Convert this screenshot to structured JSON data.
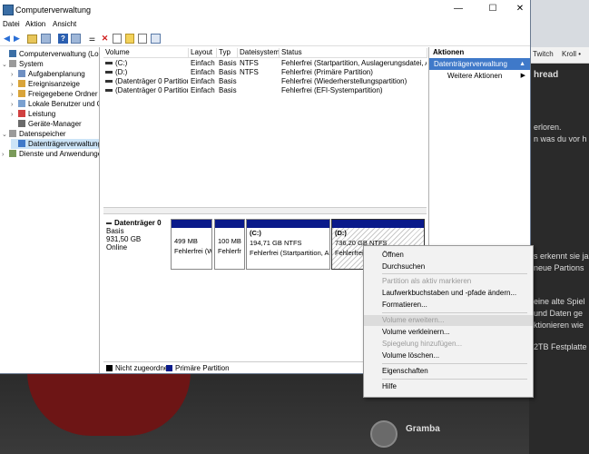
{
  "window": {
    "title": "Computerverwaltung",
    "minimize_icon": "—",
    "maximize_icon": "☐",
    "close_icon": "✕"
  },
  "menu": [
    "Datei",
    "Aktion",
    "Ansicht"
  ],
  "tree": [
    {
      "label": "Computerverwaltung (Lokal)",
      "level": 0,
      "caret": ""
    },
    {
      "label": "System",
      "level": 0,
      "caret": "⌄"
    },
    {
      "label": "Aufgabenplanung",
      "level": 1,
      "caret": "›"
    },
    {
      "label": "Ereignisanzeige",
      "level": 1,
      "caret": "›"
    },
    {
      "label": "Freigegebene Ordner",
      "level": 1,
      "caret": "›"
    },
    {
      "label": "Lokale Benutzer und Gr",
      "level": 1,
      "caret": "›"
    },
    {
      "label": "Leistung",
      "level": 1,
      "caret": "›"
    },
    {
      "label": "Geräte-Manager",
      "level": 1,
      "caret": ""
    },
    {
      "label": "Datenspeicher",
      "level": 0,
      "caret": "⌄"
    },
    {
      "label": "Datenträgerverwaltung",
      "level": 1,
      "caret": ""
    },
    {
      "label": "Dienste und Anwendungen",
      "level": 0,
      "caret": "›"
    }
  ],
  "table": {
    "headers": [
      "Volume",
      "Layout",
      "Typ",
      "Dateisystem",
      "Status"
    ],
    "rows": [
      [
        "(C:)",
        "Einfach",
        "Basis",
        "NTFS",
        "Fehlerfrei (Startpartition, Auslagerungsdatei, Abstu"
      ],
      [
        "(D:)",
        "Einfach",
        "Basis",
        "NTFS",
        "Fehlerfrei (Primäre Partition)"
      ],
      [
        "(Datenträger 0 Partition 1)",
        "Einfach",
        "Basis",
        "",
        "Fehlerfrei (Wiederherstellungspartition)"
      ],
      [
        "(Datenträger 0 Partition 2)",
        "Einfach",
        "Basis",
        "",
        "Fehlerfrei (EFI-Systempartition)"
      ]
    ]
  },
  "disk": {
    "name": "Datenträger 0",
    "type": "Basis",
    "size": "931,50 GB",
    "status": "Online",
    "partitions": [
      {
        "title": "",
        "size": "499 MB",
        "status": "Fehlerfrei (W"
      },
      {
        "title": "",
        "size": "100 MB",
        "status": "Fehlerfr"
      },
      {
        "title": "(C:)",
        "size": "194,71 GB NTFS",
        "status": "Fehlerfrei (Startpartition, A"
      },
      {
        "title": "(D:)",
        "size": "736,20 GB NTFS",
        "status": "Fehlerfrei (Pri"
      }
    ]
  },
  "legend": {
    "unallocated": "Nicht zugeordnet",
    "primary": "Primäre Partition",
    "unallocated_color": "#000000",
    "primary_color": "#0a1a8a"
  },
  "actions": {
    "header": "Aktionen",
    "selected": "Datenträgerverwaltung",
    "more": "Weitere Aktionen"
  },
  "context_menu": [
    {
      "label": "Öffnen",
      "disabled": false
    },
    {
      "label": "Durchsuchen",
      "disabled": false
    },
    {
      "label": "Partition als aktiv markieren",
      "disabled": true
    },
    {
      "label": "Laufwerkbuchstaben und -pfade ändern...",
      "disabled": false
    },
    {
      "label": "Formatieren...",
      "disabled": false
    },
    {
      "label": "Volume erweitern...",
      "disabled": true
    },
    {
      "label": "Volume verkleinern...",
      "disabled": false
    },
    {
      "label": "Spiegelung hinzufügen...",
      "disabled": true
    },
    {
      "label": "Volume löschen...",
      "disabled": false
    },
    {
      "label": "Eigenschaften",
      "disabled": false
    },
    {
      "label": "Hilfe",
      "disabled": false
    }
  ],
  "background": {
    "tabs": [
      "Twitch",
      "Kroll •"
    ],
    "thread": "hread",
    "lines": [
      "erloren.",
      "n was du vor h",
      "s erkennt sie ja",
      "neue Partions",
      "eine alte Spiel",
      "und Daten ge",
      "ktionieren wie",
      "2TB Festplatte"
    ],
    "author": "Gramba"
  },
  "accent_color": "#3f79c9"
}
